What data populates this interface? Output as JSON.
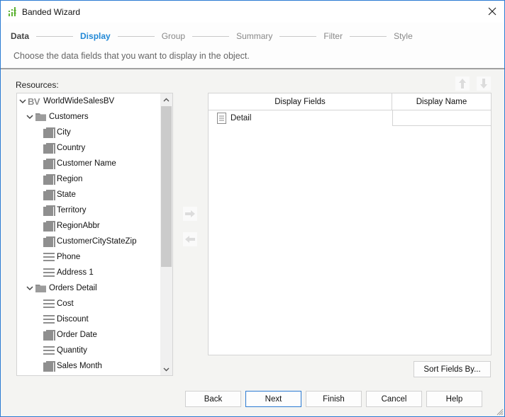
{
  "window": {
    "title": "Banded Wizard",
    "icons": {
      "app": "banded-wizard-app-icon",
      "close": "close-icon"
    }
  },
  "wizard": {
    "steps": [
      {
        "label": "Data",
        "state": "done"
      },
      {
        "label": "Display",
        "state": "active"
      },
      {
        "label": "Group",
        "state": "pending"
      },
      {
        "label": "Summary",
        "state": "pending"
      },
      {
        "label": "Filter",
        "state": "pending"
      },
      {
        "label": "Style",
        "state": "pending"
      }
    ],
    "instruction": "Choose the data fields that you want to display in the object."
  },
  "resources": {
    "label": "Resources:",
    "tree": [
      {
        "label": "WorldWideSalesBV",
        "type": "business-view",
        "badge": "BV",
        "level": 0,
        "expanded": true
      },
      {
        "label": "Customers",
        "type": "folder",
        "level": 1,
        "expanded": true
      },
      {
        "label": "City",
        "type": "group-field",
        "level": 2
      },
      {
        "label": "Country",
        "type": "group-field",
        "level": 2
      },
      {
        "label": "Customer Name",
        "type": "group-field",
        "level": 2
      },
      {
        "label": "Region",
        "type": "group-field",
        "level": 2
      },
      {
        "label": "State",
        "type": "group-field",
        "level": 2
      },
      {
        "label": "Territory",
        "type": "group-field",
        "level": 2
      },
      {
        "label": "RegionAbbr",
        "type": "group-field",
        "level": 2
      },
      {
        "label": "CustomerCityStateZip",
        "type": "group-field",
        "level": 2
      },
      {
        "label": "Phone",
        "type": "detail-field",
        "level": 2
      },
      {
        "label": "Address 1",
        "type": "detail-field",
        "level": 2
      },
      {
        "label": "Orders Detail",
        "type": "folder",
        "level": 1,
        "expanded": true
      },
      {
        "label": "Cost",
        "type": "detail-field",
        "level": 2
      },
      {
        "label": "Discount",
        "type": "detail-field",
        "level": 2
      },
      {
        "label": "Order Date",
        "type": "group-field",
        "level": 2
      },
      {
        "label": "Quantity",
        "type": "detail-field",
        "level": 2
      },
      {
        "label": "Sales Month",
        "type": "group-field",
        "level": 2
      }
    ]
  },
  "transfer": {
    "add_icon": "arrow-right-icon",
    "remove_icon": "arrow-left-icon",
    "move_up_icon": "arrow-up-icon",
    "move_down_icon": "arrow-down-icon"
  },
  "display_grid": {
    "columns": [
      "Display Fields",
      "Display Name"
    ],
    "rows": [
      {
        "field": "Detail",
        "icon": "detail-section-icon",
        "display_name": ""
      }
    ]
  },
  "buttons": {
    "sort_fields": "Sort Fields By...",
    "back": "Back",
    "next": "Next",
    "finish": "Finish",
    "cancel": "Cancel",
    "help": "Help"
  },
  "colors": {
    "accent": "#2188d6",
    "window_border": "#2b7bd3",
    "app_icon": "#5fb336"
  }
}
